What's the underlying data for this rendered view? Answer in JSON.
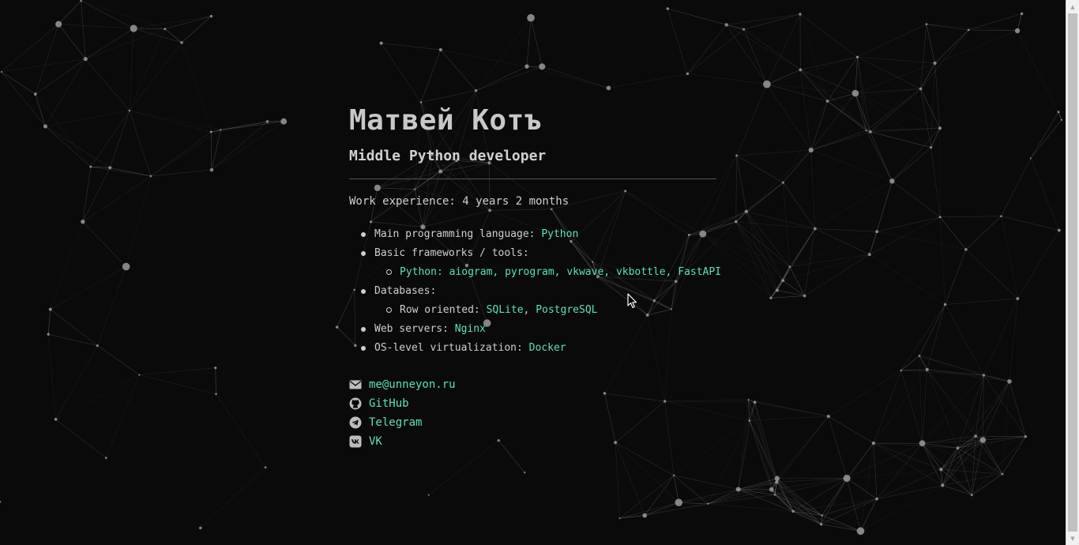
{
  "profile": {
    "name": "Матвей Котъ",
    "role": "Middle Python developer",
    "experience": "Work experience: 4 years 2 months"
  },
  "skills": {
    "main_language_label": "Main programming language: ",
    "main_language": "Python",
    "frameworks_label": "Basic frameworks / tools:",
    "python_label": "Python: ",
    "python_tools": "aiogram, pyrogram, vkwave, vkbottle, FastAPI",
    "databases_label": "Databases:",
    "row_oriented_label": "Row oriented: ",
    "db_sqlite": "SQLite",
    "db_sep": ", ",
    "db_postgres": "PostgreSQL",
    "web_servers_label": "Web servers: ",
    "web_server": "Nginx",
    "virtualization_label": "OS-level virtualization: ",
    "virtualization": "Docker"
  },
  "contacts": [
    {
      "icon": "envelope-icon",
      "label": "me@unneyon.ru"
    },
    {
      "icon": "github-icon",
      "label": "GitHub"
    },
    {
      "icon": "telegram-icon",
      "label": "Telegram"
    },
    {
      "icon": "vk-icon",
      "label": "VK"
    }
  ],
  "colors": {
    "background": "#0a0a0a",
    "accent": "#5ee0b7",
    "text": "#cfcfcf",
    "network": "#8a8a8a"
  }
}
